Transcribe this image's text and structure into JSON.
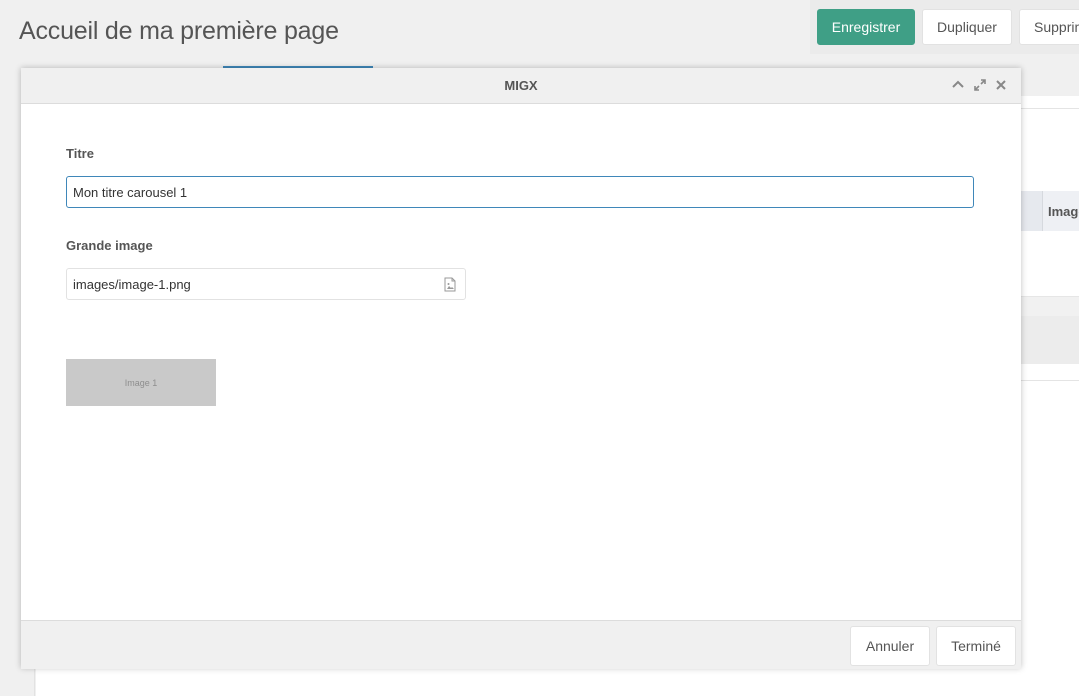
{
  "page": {
    "title": "Accueil de ma première page"
  },
  "actions": {
    "save_label": "Enregistrer",
    "duplicate_label": "Dupliquer",
    "delete_label": "Supprimer"
  },
  "background": {
    "column_header": "Image"
  },
  "modal": {
    "title": "MIGX",
    "tools": [
      "chevron-up-icon",
      "expand-icon",
      "close-icon"
    ],
    "fields": {
      "titre_label": "Titre",
      "titre_value": "Mon titre carousel 1",
      "image_label": "Grande image",
      "image_value": "images/image-1.png"
    },
    "preview_text": "Image 1",
    "footer": {
      "cancel_label": "Annuler",
      "done_label": "Terminé"
    }
  },
  "colors": {
    "primary": "#3f9f86",
    "focus": "#3f87b9"
  }
}
